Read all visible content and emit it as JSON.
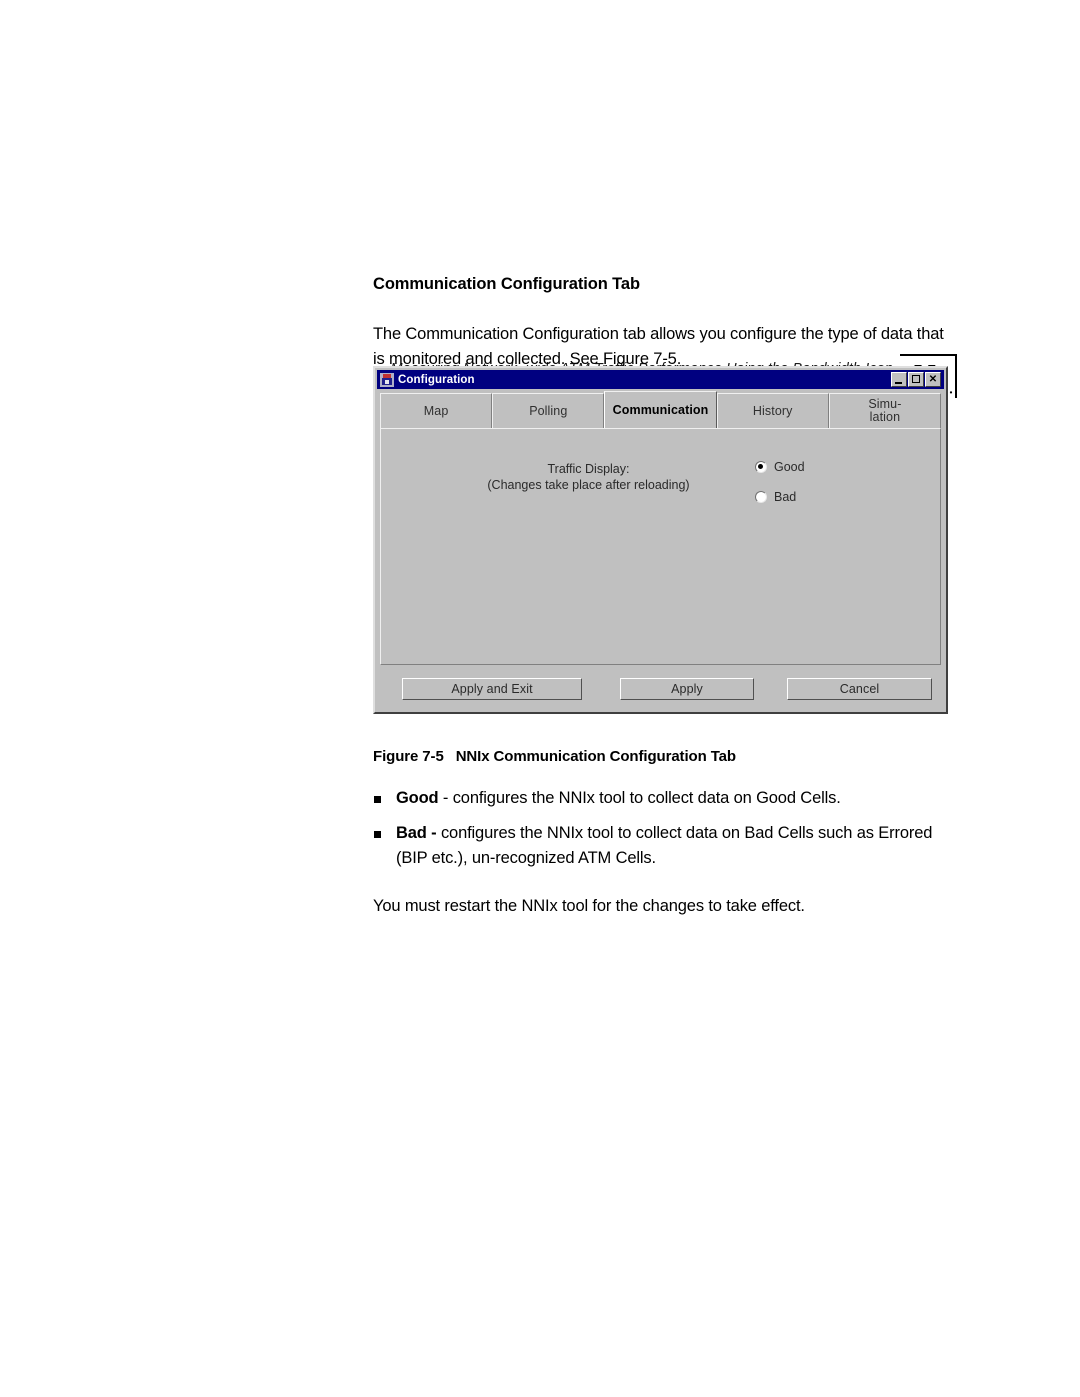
{
  "header": {
    "running_title": "Measuring Network -wide ATM Traffic Performance Using the Bandwidth Icon",
    "page_number": "7-7"
  },
  "section": {
    "heading": "Communication Configuration Tab",
    "intro": "The Communication Configuration tab allows you configure the type of data that is monitored and collected. See Figure 7-5."
  },
  "figure": {
    "caption_label": "Figure 7-5",
    "caption_text": "NNIx Communication Configuration Tab",
    "dialog": {
      "title": "Configuration",
      "title_icon": "config-window-icon",
      "window_controls": [
        {
          "name": "minimize-button",
          "glyph": "minimize-icon"
        },
        {
          "name": "maximize-button",
          "glyph": "maximize-icon"
        },
        {
          "name": "close-button",
          "glyph": "close-icon",
          "label": "✕"
        }
      ],
      "tabs": [
        {
          "label": "Map",
          "selected": false
        },
        {
          "label": "Polling",
          "selected": false
        },
        {
          "label": "Communication",
          "selected": true
        },
        {
          "label": "History",
          "selected": false
        },
        {
          "label": "Simu-\nlation",
          "line1": "Simu-",
          "line2": "lation",
          "selected": false
        }
      ],
      "traffic_display": {
        "label_line1": "Traffic Display:",
        "label_line2": "(Changes take place after reloading)",
        "options": [
          {
            "label": "Good",
            "checked": true
          },
          {
            "label": "Bad",
            "checked": false
          }
        ]
      },
      "buttons": [
        {
          "label": "Apply and Exit"
        },
        {
          "label": "Apply"
        },
        {
          "label": "Cancel"
        }
      ]
    }
  },
  "bullets": [
    {
      "term": "Good",
      "rest": " - configures the NNIx tool to collect data on Good Cells."
    },
    {
      "term": "Bad -",
      "rest": " configures the NNIx tool to collect data on Bad Cells such as Errored (BIP etc.), un-recognized ATM Cells."
    }
  ],
  "closing_paragraph": "You must restart the NNIx tool for the changes to take effect.",
  "colors": {
    "titlebar": "#000080",
    "dialog_face": "#c0c0c0",
    "page_background": "#ffffff",
    "text": "#000000"
  }
}
